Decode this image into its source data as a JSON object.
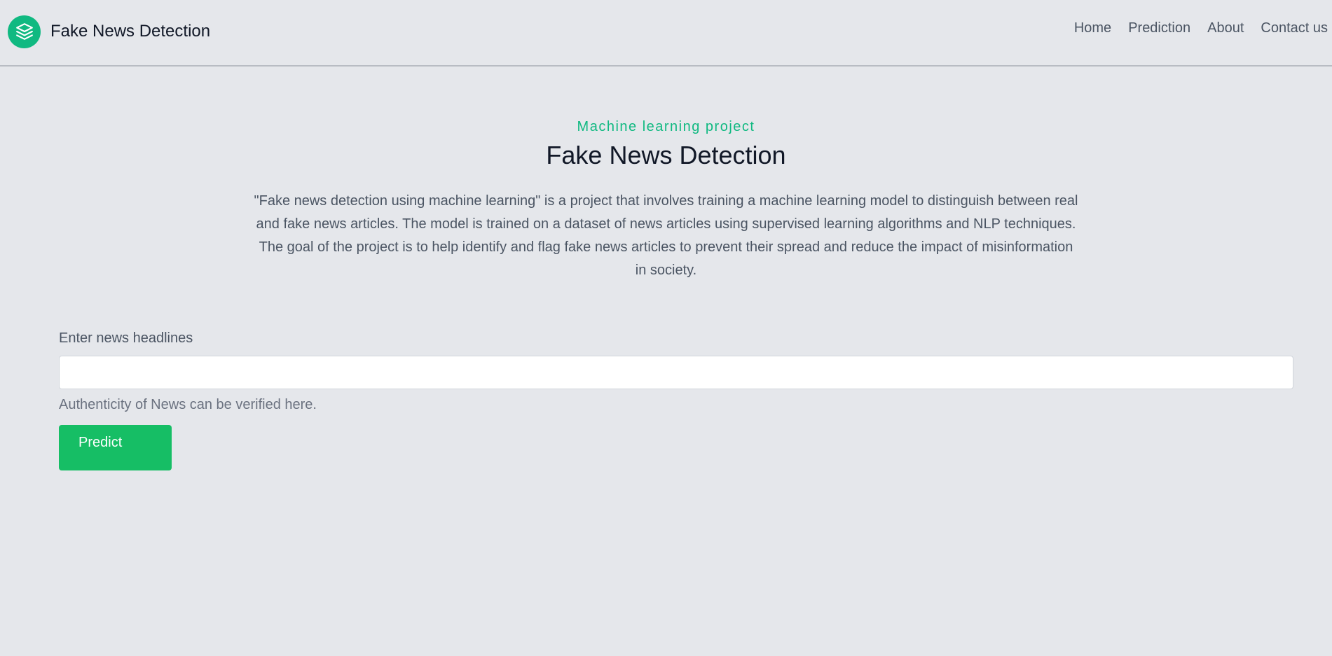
{
  "header": {
    "brand_name": "Fake News Detection",
    "logo_icon": "layers-icon",
    "nav": [
      {
        "label": "Home"
      },
      {
        "label": "Prediction"
      },
      {
        "label": "About"
      },
      {
        "label": "Contact us"
      }
    ]
  },
  "hero": {
    "eyebrow": "Machine learning project",
    "title": "Fake News Detection",
    "description": "\"Fake news detection using machine learning\" is a project that involves training a machine learning model to distinguish between real and fake news articles. The model is trained on a dataset of news articles using supervised learning algorithms and NLP techniques. The goal of the project is to help identify and flag fake news articles to prevent their spread and reduce the impact of misinformation in society."
  },
  "form": {
    "label": "Enter news headlines",
    "input_value": "",
    "input_placeholder": "",
    "help_text": "Authenticity of News can be verified here.",
    "submit_label": "Predict"
  },
  "colors": {
    "accent": "#10b981",
    "button": "#16be65",
    "background": "#e5e7eb",
    "heading": "#111827",
    "text": "#4b5563"
  }
}
